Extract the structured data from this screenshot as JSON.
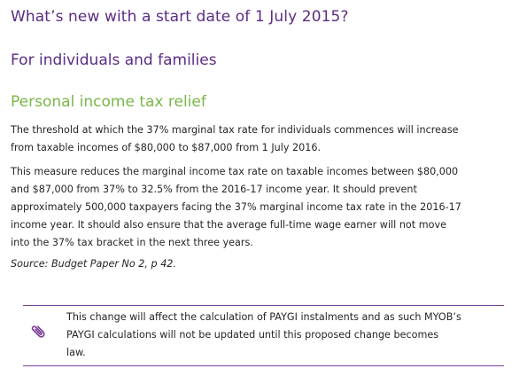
{
  "document": {
    "heading_main": "What’s new with a start date of 1 July 2015?",
    "heading_section": "For individuals and families",
    "heading_subsection": "Personal income tax relief",
    "paragraph_1_lines": [
      "The threshold at which the 37% marginal tax rate for individuals commences will increase",
      "from taxable incomes of $80,000 to $87,000 from 1 July 2016."
    ],
    "paragraph_2_lines": [
      "This measure reduces the marginal income tax rate on taxable incomes between $80,000",
      "and $87,000 from 37% to 32.5% from the 2016-17 income year. It should prevent",
      "approximately 500,000 taxpayers facing the 37% marginal income tax rate in the 2016-17",
      "income year. It should also ensure that the average full-time wage earner will not move",
      "into the 37% tax bracket in the next three years."
    ],
    "source": "Source: Budget Paper No 2, p 42."
  },
  "note": {
    "icon": "paperclip-icon",
    "lines": [
      "This change will affect the calculation of PAYGI instalments and as such MYOB’s",
      "PAYGI calculations will not be updated until this proposed change becomes",
      "law."
    ]
  },
  "colors": {
    "heading_purple": "#5b2c83",
    "heading_green": "#7ab648",
    "rule_purple": "#7b3f98",
    "body_text": "#262626"
  }
}
